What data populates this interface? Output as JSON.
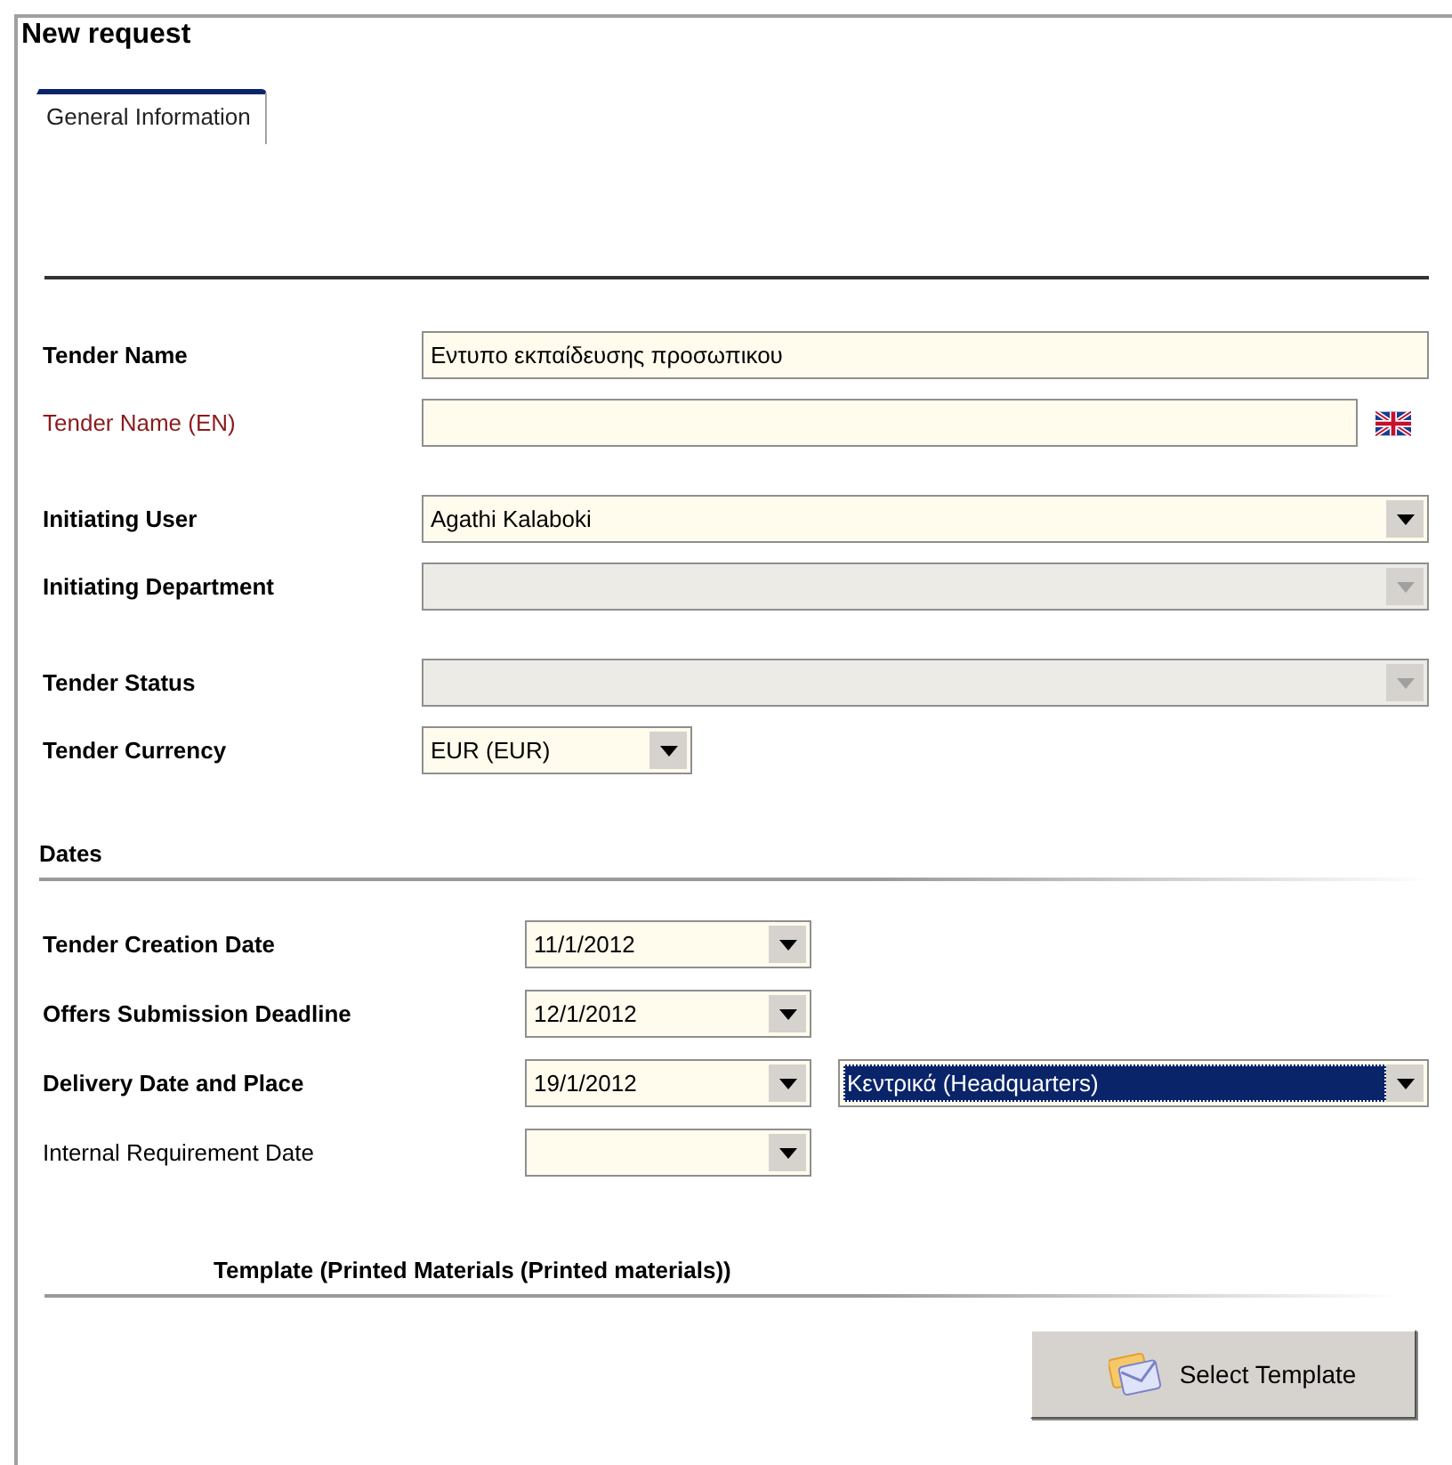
{
  "window": {
    "title": "New request"
  },
  "tabs": [
    {
      "label": "General Information",
      "selected": true
    }
  ],
  "general_groups": [
    [
      {
        "label": "Tender Name",
        "required": true,
        "translated": false,
        "kind": "text",
        "value": "Εντυπο εκπαίδευσης προσωπικου",
        "disabled": false
      },
      {
        "label": "Tender Name (EN)",
        "required": false,
        "translated": true,
        "kind": "text",
        "disabled": false,
        "flag": true
      }
    ],
    [
      {
        "label": "Initiating User",
        "required": true,
        "translated": false,
        "kind": "select",
        "value": "Agathi Kalaboki",
        "disabled": false
      },
      {
        "label": "Initiating Department",
        "required": true,
        "translated": false,
        "kind": "select",
        "disabled": true
      }
    ],
    [
      {
        "label": "Tender Status",
        "required": true,
        "translated": false,
        "kind": "select",
        "disabled": true
      },
      {
        "label": "Tender Currency",
        "required": true,
        "translated": false,
        "kind": "compact",
        "value": "EUR (EUR)",
        "disabled": false
      }
    ]
  ],
  "dates": {
    "heading": "Dates",
    "rows": [
      {
        "label": "Tender Creation Date",
        "required": true,
        "date": "11/1/2012"
      },
      {
        "label": "Offers Submission Deadline",
        "required": true,
        "date": "12/1/2012"
      },
      {
        "label": "Delivery Date and Place",
        "required": true,
        "date": "19/1/2012",
        "place": {
          "value": "Κεντρικά (Headquarters)",
          "selected": true
        }
      },
      {
        "label": "Internal Requirement Date",
        "required": false
      }
    ]
  },
  "template": {
    "heading": "Template (Printed Materials (Printed materials))",
    "button": "Select Template"
  }
}
